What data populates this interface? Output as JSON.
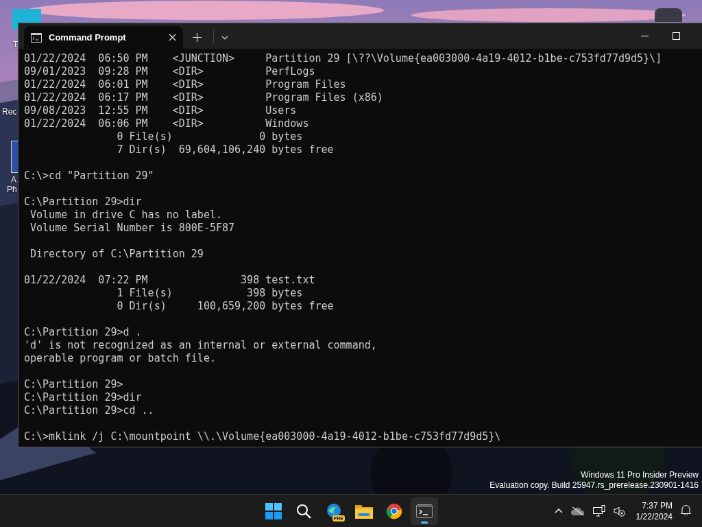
{
  "desktop": {
    "icons": [
      {
        "labels": [
          "T"
        ]
      },
      {
        "labels": [
          "Rec"
        ]
      },
      {
        "labels": [
          "A",
          "Ph"
        ]
      }
    ],
    "watermark": [
      "Windows 11 Pro Insider Preview",
      "Evaluation copy. Build 25947.rs_prerelease.230901-1416"
    ]
  },
  "window": {
    "tabs": [
      {
        "title": "Command Prompt",
        "selected": true
      }
    ],
    "lines": [
      {
        "kind": "text",
        "text": "01/22/2024  06:50 PM    <JUNCTION>     Partition 29 [\\??\\Volume{ea003000-4a19-4012-b1be-c753fd77d9d5}\\]"
      },
      {
        "kind": "text",
        "text": "09/01/2023  09:28 PM    <DIR>          PerfLogs"
      },
      {
        "kind": "text",
        "text": "01/22/2024  06:01 PM    <DIR>          Program Files"
      },
      {
        "kind": "text",
        "text": "01/22/2024  06:17 PM    <DIR>          Program Files (x86)"
      },
      {
        "kind": "text",
        "text": "09/08/2023  12:55 PM    <DIR>          Users"
      },
      {
        "kind": "text",
        "text": "01/22/2024  06:06 PM    <DIR>          Windows"
      },
      {
        "kind": "text",
        "text": "               0 File(s)              0 bytes"
      },
      {
        "kind": "text",
        "text": "               7 Dir(s)  69,604,106,240 bytes free"
      },
      {
        "kind": "blank"
      },
      {
        "kind": "text",
        "text": "C:\\>cd \"Partition 29\""
      },
      {
        "kind": "blank"
      },
      {
        "kind": "text",
        "text": "C:\\Partition 29>dir"
      },
      {
        "kind": "text",
        "text": " Volume in drive C has no label."
      },
      {
        "kind": "text",
        "text": " Volume Serial Number is 800E-5F87"
      },
      {
        "kind": "blank"
      },
      {
        "kind": "text",
        "text": " Directory of C:\\Partition 29"
      },
      {
        "kind": "blank"
      },
      {
        "kind": "text",
        "text": "01/22/2024  07:22 PM               398 test.txt"
      },
      {
        "kind": "text",
        "text": "               1 File(s)            398 bytes"
      },
      {
        "kind": "text",
        "text": "               0 Dir(s)     100,659,200 bytes free"
      },
      {
        "kind": "blank"
      },
      {
        "kind": "text",
        "text": "C:\\Partition 29>d ."
      },
      {
        "kind": "text",
        "text": "'d' is not recognized as an internal or external command,"
      },
      {
        "kind": "text",
        "text": "operable program or batch file."
      },
      {
        "kind": "blank"
      },
      {
        "kind": "text",
        "text": "C:\\Partition 29>"
      },
      {
        "kind": "text",
        "text": "C:\\Partition 29>dir"
      },
      {
        "kind": "text",
        "text": "C:\\Partition 29>cd .."
      },
      {
        "kind": "blank"
      },
      {
        "kind": "text",
        "text": "C:\\>mklink /j C:\\mountpoint \\\\.\\Volume{ea003000-4a19-4012-b1be-c753fd77d9d5}\\"
      }
    ]
  },
  "taskbar": {
    "apps": [
      {
        "kind": "start",
        "selected": false
      },
      {
        "kind": "search",
        "selected": false
      },
      {
        "kind": "edge",
        "badge": "PRE",
        "selected": false
      },
      {
        "kind": "explorer",
        "selected": false
      },
      {
        "kind": "chrome",
        "selected": false
      },
      {
        "kind": "terminal",
        "selected": true
      }
    ],
    "tray": {
      "time": "7:37 PM",
      "date": "1/22/2024"
    }
  }
}
